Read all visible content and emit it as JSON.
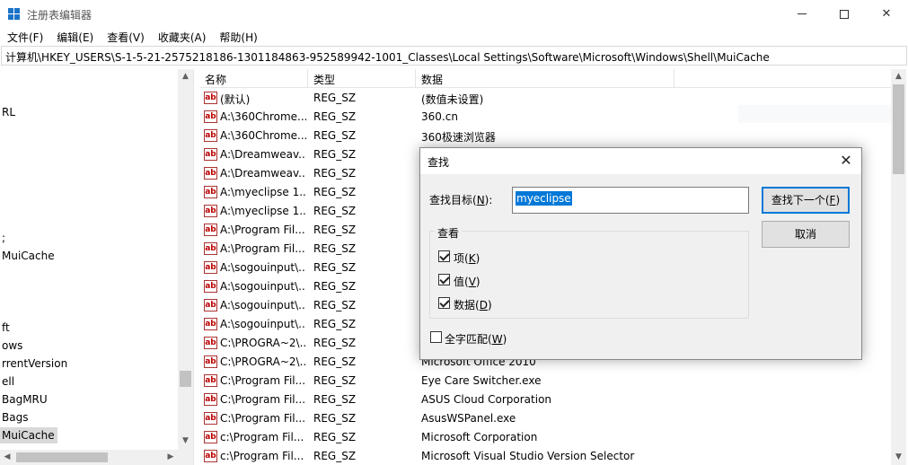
{
  "window": {
    "title": "注册表编辑器",
    "minimize_glyph": "—",
    "close_glyph": "✕"
  },
  "menu": {
    "file": "文件(F)",
    "edit": "编辑(E)",
    "view": "查看(V)",
    "favorites": "收藏夹(A)",
    "help": "帮助(H)"
  },
  "address": "计算机\\HKEY_USERS\\S-1-5-21-2575218186-1301184863-952589942-1001_Classes\\Local Settings\\Software\\Microsoft\\Windows\\Shell\\MuiCache",
  "tree": {
    "items": [
      {
        "label": "RL"
      },
      {
        "label": ";"
      },
      {
        "label": "MuiCache"
      },
      {
        "label": "ft"
      },
      {
        "label": "ows"
      },
      {
        "label": "rrentVersion"
      },
      {
        "label": "ell"
      },
      {
        "label": "BagMRU"
      },
      {
        "label": "Bags"
      },
      {
        "label": "MuiCache"
      }
    ],
    "up_arrow": "▲",
    "down_arrow": "▼",
    "left_arrow": "◀",
    "right_arrow": "▶"
  },
  "list": {
    "columns": {
      "name": "名称",
      "type": "类型",
      "data": "数据"
    },
    "icon_text": "ab",
    "rows": [
      {
        "name": "(默认)",
        "type": "REG_SZ",
        "data": "(数值未设置)"
      },
      {
        "name": "A:\\360Chrome...",
        "type": "REG_SZ",
        "data": "360.cn"
      },
      {
        "name": "A:\\360Chrome...",
        "type": "REG_SZ",
        "data": "360极速浏览器"
      },
      {
        "name": "A:\\Dreamweav...",
        "type": "REG_SZ",
        "data": ""
      },
      {
        "name": "A:\\Dreamweav...",
        "type": "REG_SZ",
        "data": ""
      },
      {
        "name": "A:\\myeclipse 1...",
        "type": "REG_SZ",
        "data": ""
      },
      {
        "name": "A:\\myeclipse 1...",
        "type": "REG_SZ",
        "data": ""
      },
      {
        "name": "A:\\Program Fil...",
        "type": "REG_SZ",
        "data": ""
      },
      {
        "name": "A:\\Program Fil...",
        "type": "REG_SZ",
        "data": ""
      },
      {
        "name": "A:\\sogouinput\\...",
        "type": "REG_SZ",
        "data": ""
      },
      {
        "name": "A:\\sogouinput\\...",
        "type": "REG_SZ",
        "data": ""
      },
      {
        "name": "A:\\sogouinput\\...",
        "type": "REG_SZ",
        "data": ""
      },
      {
        "name": "A:\\sogouinput\\...",
        "type": "REG_SZ",
        "data": ""
      },
      {
        "name": "C:\\PROGRA~2\\...",
        "type": "REG_SZ",
        "data": ""
      },
      {
        "name": "C:\\PROGRA~2\\...",
        "type": "REG_SZ",
        "data": "Microsoft Office 2010"
      },
      {
        "name": "C:\\Program Fil...",
        "type": "REG_SZ",
        "data": "Eye Care Switcher.exe"
      },
      {
        "name": "C:\\Program Fil...",
        "type": "REG_SZ",
        "data": "ASUS Cloud Corporation"
      },
      {
        "name": "C:\\Program Fil...",
        "type": "REG_SZ",
        "data": "AsusWSPanel.exe"
      },
      {
        "name": "c:\\Program Fil...",
        "type": "REG_SZ",
        "data": "Microsoft Corporation"
      },
      {
        "name": "c:\\Program Fil...",
        "type": "REG_SZ",
        "data": "Microsoft Visual Studio Version Selector"
      }
    ]
  },
  "find_dialog": {
    "title": "查找",
    "close_glyph": "✕",
    "target_label_prefix": "查找目标(",
    "target_label_key": "N",
    "target_label_suffix": "):",
    "target_value": "myeclipse",
    "find_next_prefix": "查找下一个(",
    "find_next_key": "F",
    "find_next_suffix": ")",
    "cancel": "取消",
    "look_at_title": "查看",
    "options": [
      {
        "prefix": "项(",
        "key": "K",
        "suffix": ")",
        "checked": true
      },
      {
        "prefix": "值(",
        "key": "V",
        "suffix": ")",
        "checked": true
      },
      {
        "prefix": "数据(",
        "key": "D",
        "suffix": ")",
        "checked": true
      }
    ],
    "whole_match": {
      "prefix": "全字匹配(",
      "key": "W",
      "suffix": ")",
      "checked": false
    }
  }
}
